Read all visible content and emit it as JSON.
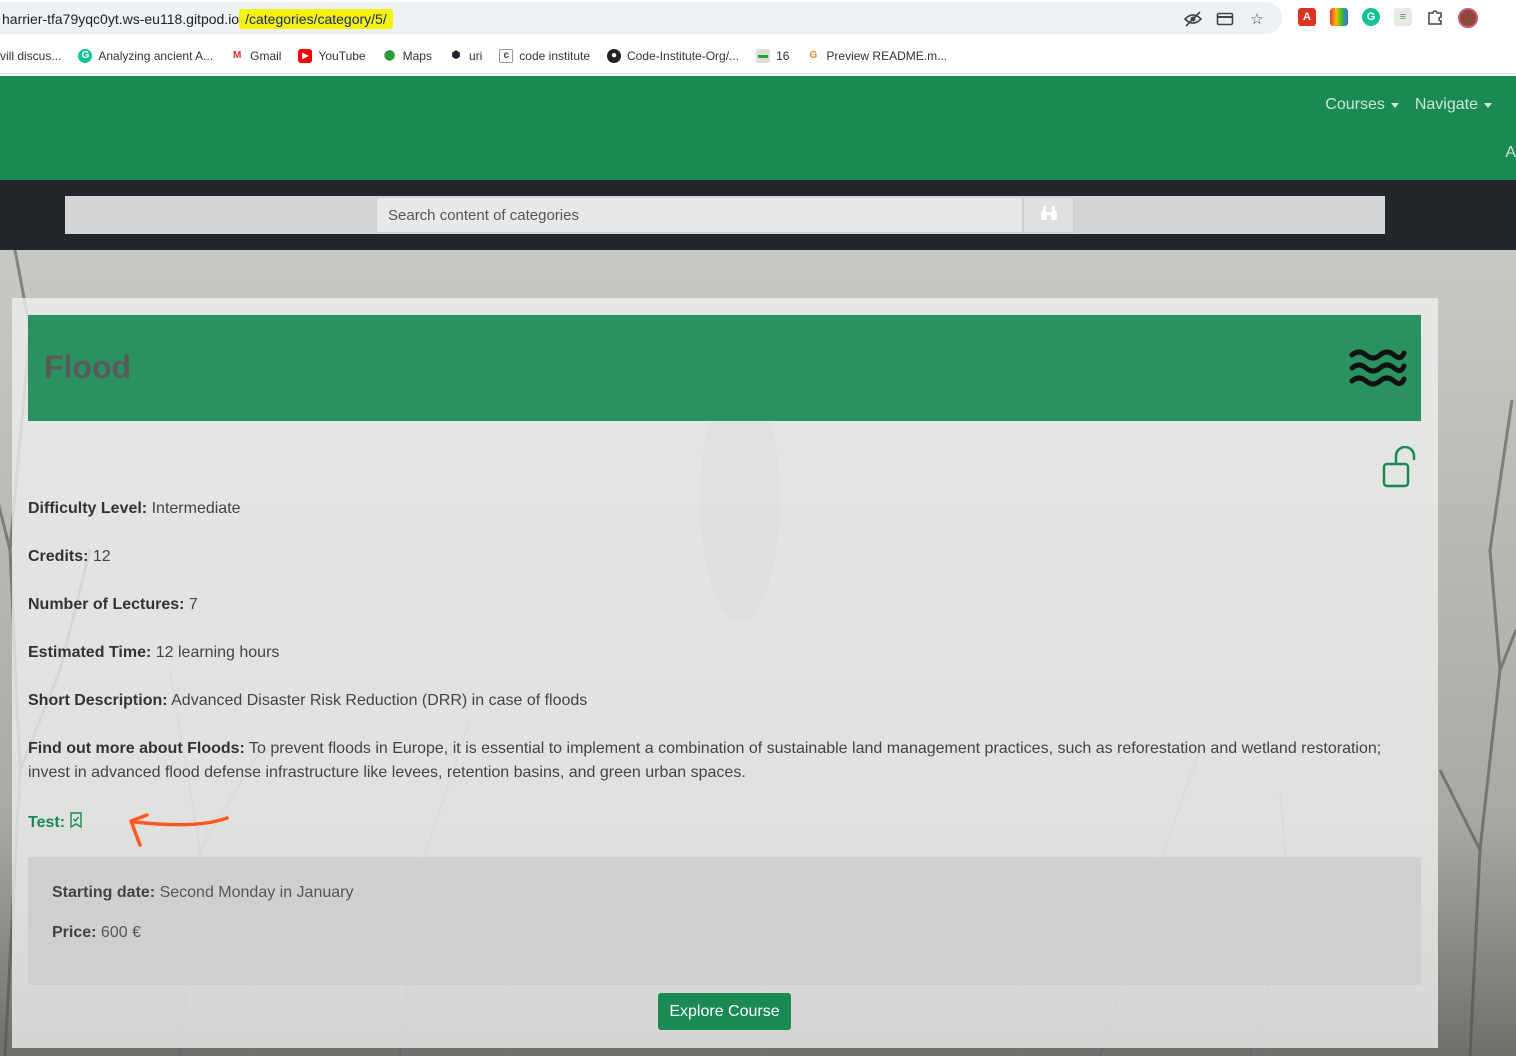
{
  "browser": {
    "url_prefix": "harrier-tfa79yqc0yt.ws-eu118.gitpod.io",
    "url_highlight": "/categories/category/5/",
    "bookmarks": [
      {
        "label": "vill discus..."
      },
      {
        "label": "Analyzing ancient A..."
      },
      {
        "label": "Gmail"
      },
      {
        "label": "YouTube"
      },
      {
        "label": "Maps"
      },
      {
        "label": "uri"
      },
      {
        "label": "code institute"
      },
      {
        "label": "Code-Institute-Org/..."
      },
      {
        "label": "16"
      },
      {
        "label": "Preview README.m..."
      }
    ]
  },
  "nav": {
    "courses": "Courses",
    "navigate": "Navigate",
    "extra": "A"
  },
  "search": {
    "placeholder": "Search content of categories"
  },
  "category": {
    "title": "Flood",
    "difficulty_label": "Difficulty Level:",
    "difficulty": "Intermediate",
    "credits_label": "Credits:",
    "credits": "12",
    "lectures_label": "Number of Lectures:",
    "lectures": "7",
    "time_label": "Estimated Time:",
    "time": "12 learning hours",
    "short_desc_label": "Short Description:",
    "short_desc": "Advanced Disaster Risk Reduction (DRR) in case of floods",
    "more_label": "Find out more about Floods:",
    "more": "To prevent floods in Europe, it is essential to implement a combination of sustainable land management practices, such as reforestation and wetland restoration; invest in advanced flood defense infrastructure like levees, retention basins, and green urban spaces.",
    "test_label": "Test:",
    "start_label": "Starting date:",
    "start": "Second Monday in January",
    "price_label": "Price:",
    "price": "600",
    "currency": "€",
    "explore_button": "Explore Course"
  },
  "colors": {
    "brand_green": "#1a8a55",
    "annotation_orange": "#ff5a1f",
    "url_highlight": "#f5f20e"
  }
}
